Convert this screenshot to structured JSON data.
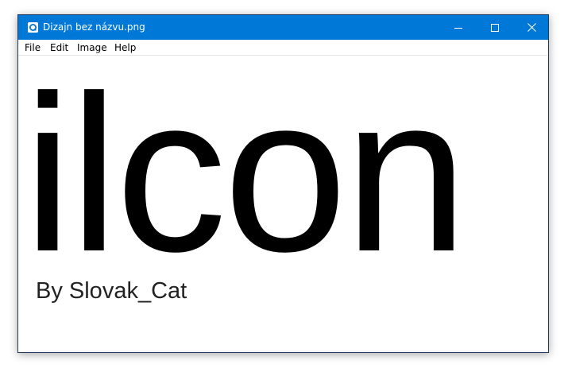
{
  "window": {
    "title": "Dizajn bez názvu.png",
    "titlebar_color": "#0078d7",
    "app_icon": "image-viewer-icon"
  },
  "caption_buttons": {
    "minimize_icon": "minimize-icon",
    "maximize_icon": "maximize-icon",
    "close_icon": "close-icon"
  },
  "menu": {
    "items": [
      {
        "label": "File"
      },
      {
        "label": "Edit"
      },
      {
        "label": "Image"
      },
      {
        "label": "Help"
      }
    ]
  },
  "image": {
    "main_text": "ilcon",
    "byline": "By Slovak_Cat"
  }
}
